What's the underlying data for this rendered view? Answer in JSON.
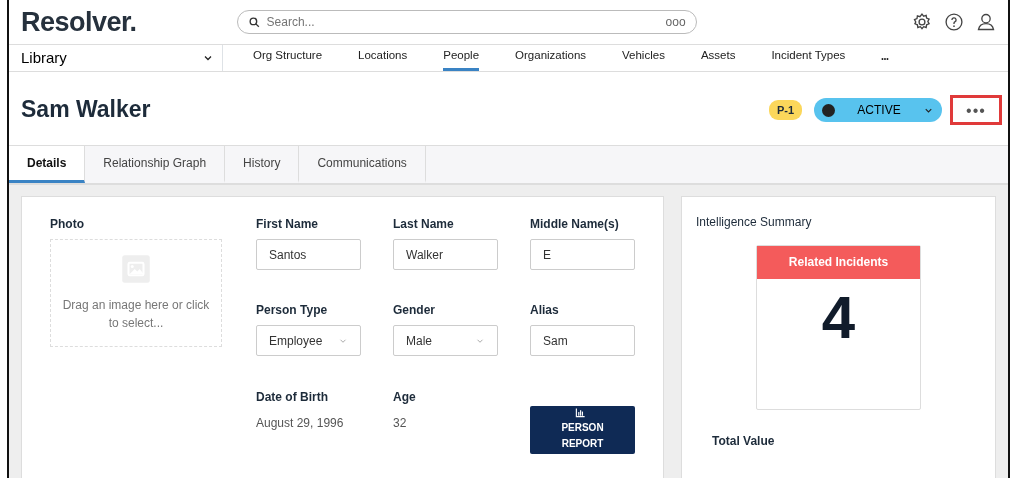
{
  "header": {
    "logo": "Resolver.",
    "search": {
      "placeholder": "Search...",
      "options": "ooo"
    }
  },
  "nav": {
    "library": "Library",
    "items": [
      {
        "label": "Org Structure",
        "selected": false
      },
      {
        "label": "Locations",
        "selected": false
      },
      {
        "label": "People",
        "selected": true
      },
      {
        "label": "Organizations",
        "selected": false
      },
      {
        "label": "Vehicles",
        "selected": false
      },
      {
        "label": "Assets",
        "selected": false
      },
      {
        "label": "Incident Types",
        "selected": false
      }
    ],
    "more": "•••"
  },
  "record": {
    "title": "Sam Walker",
    "badge": "P-1",
    "status": "ACTIVE",
    "more": "•••",
    "more_highlighted": true
  },
  "tabs": [
    {
      "label": "Details",
      "selected": true
    },
    {
      "label": "Relationship Graph",
      "selected": false
    },
    {
      "label": "History",
      "selected": false
    },
    {
      "label": "Communications",
      "selected": false
    }
  ],
  "form": {
    "photo": {
      "label": "Photo",
      "hint": "Drag an image here or click to select..."
    },
    "fields": [
      {
        "label": "First Name",
        "kind": "input",
        "value": "Santos"
      },
      {
        "label": "Last Name",
        "kind": "input",
        "value": "Walker"
      },
      {
        "label": "Middle Name(s)",
        "kind": "input",
        "value": "E"
      },
      {
        "label": "Person Type",
        "kind": "select",
        "value": "Employee"
      },
      {
        "label": "Gender",
        "kind": "select",
        "value": "Male"
      },
      {
        "label": "Alias",
        "kind": "input",
        "value": "Sam"
      },
      {
        "label": "Date of Birth",
        "kind": "text",
        "value": "August 29, 1996"
      },
      {
        "label": "Age",
        "kind": "text",
        "value": "32"
      },
      {
        "kind": "button",
        "value": "PERSON REPORT"
      }
    ]
  },
  "summary": {
    "title": "Intelligence Summary",
    "tile": {
      "label": "Related Incidents",
      "value": "4"
    },
    "total_label": "Total Value"
  }
}
